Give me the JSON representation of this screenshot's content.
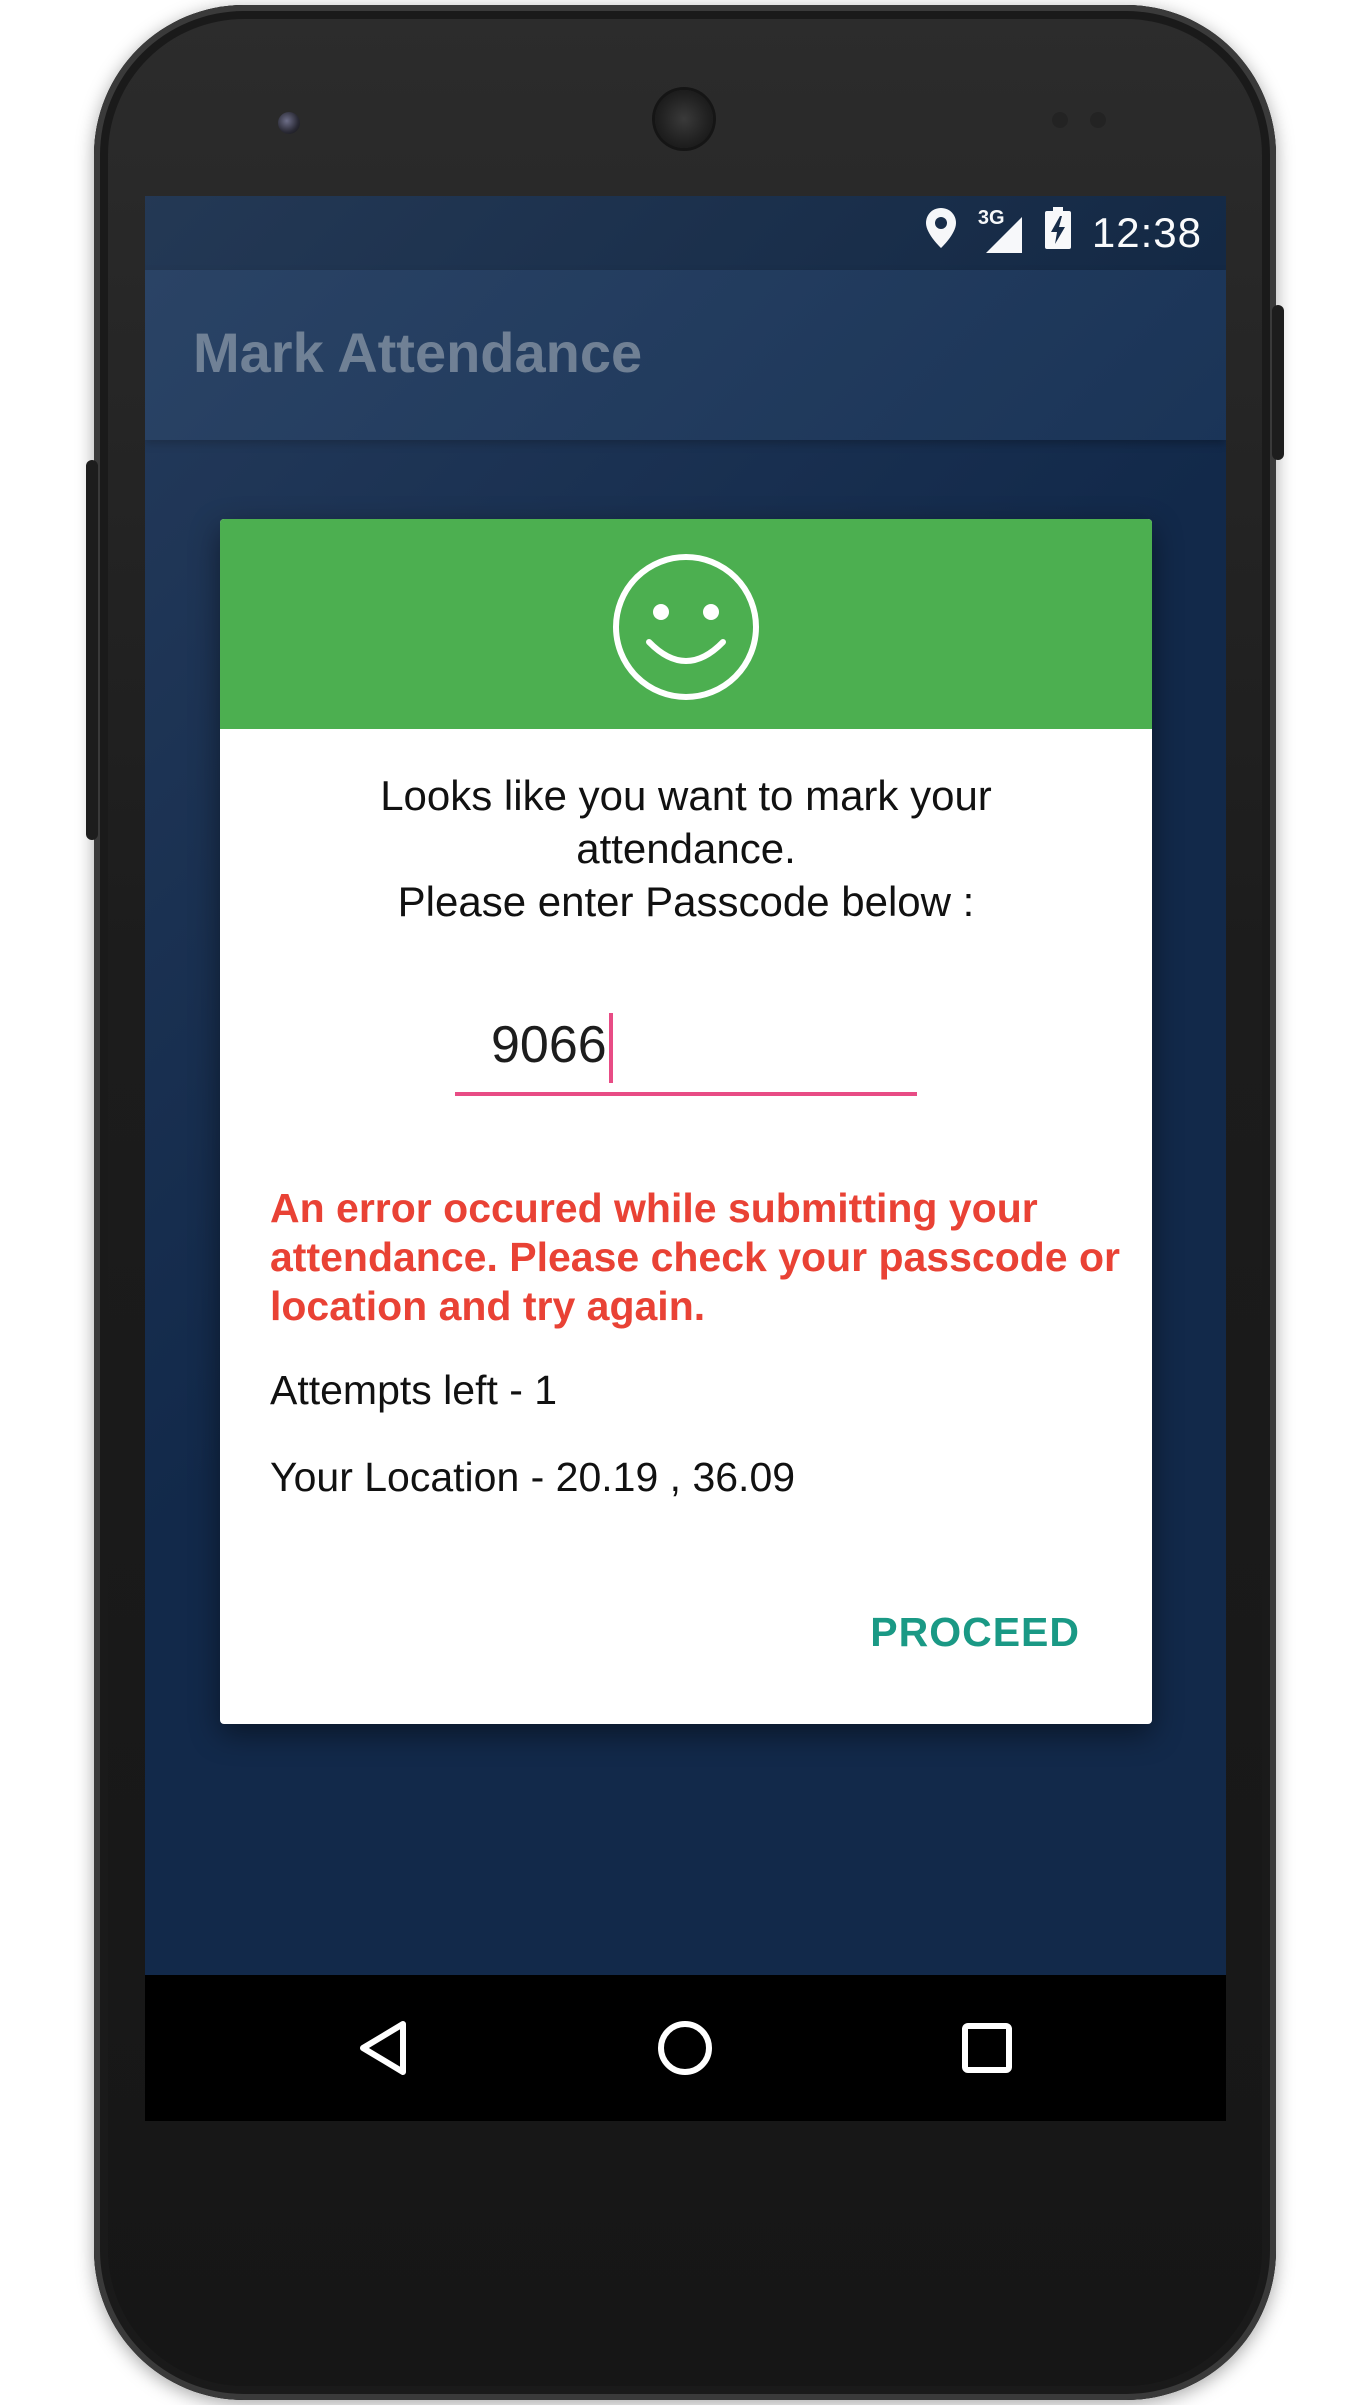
{
  "status_bar": {
    "time": "12:38",
    "network_label": "3G",
    "icons": [
      "location-icon",
      "signal-icon",
      "battery-charging-icon"
    ]
  },
  "app_bar": {
    "title": "Mark Attendance"
  },
  "dialog": {
    "header_icon": "smiley-icon",
    "header_color": "#4caf50",
    "prompt_line_1": "Looks like you want to mark your",
    "prompt_line_2": "attendance.",
    "prompt_line_3": "Please enter Passcode below :",
    "passcode_value": "9066",
    "error_line_1": "An error occured while submitting your",
    "error_line_2": "attendance. Please check your passcode or",
    "error_line_3": "location and try again.",
    "attempts_text": "Attempts left - 1",
    "location_text": "Your Location - 20.19 , 36.09",
    "proceed_label": "PROCEED",
    "error_color": "#e94235",
    "accent_color": "#e84c85"
  },
  "nav_bar": {
    "icons": [
      "back-icon",
      "home-icon",
      "recents-icon"
    ]
  }
}
